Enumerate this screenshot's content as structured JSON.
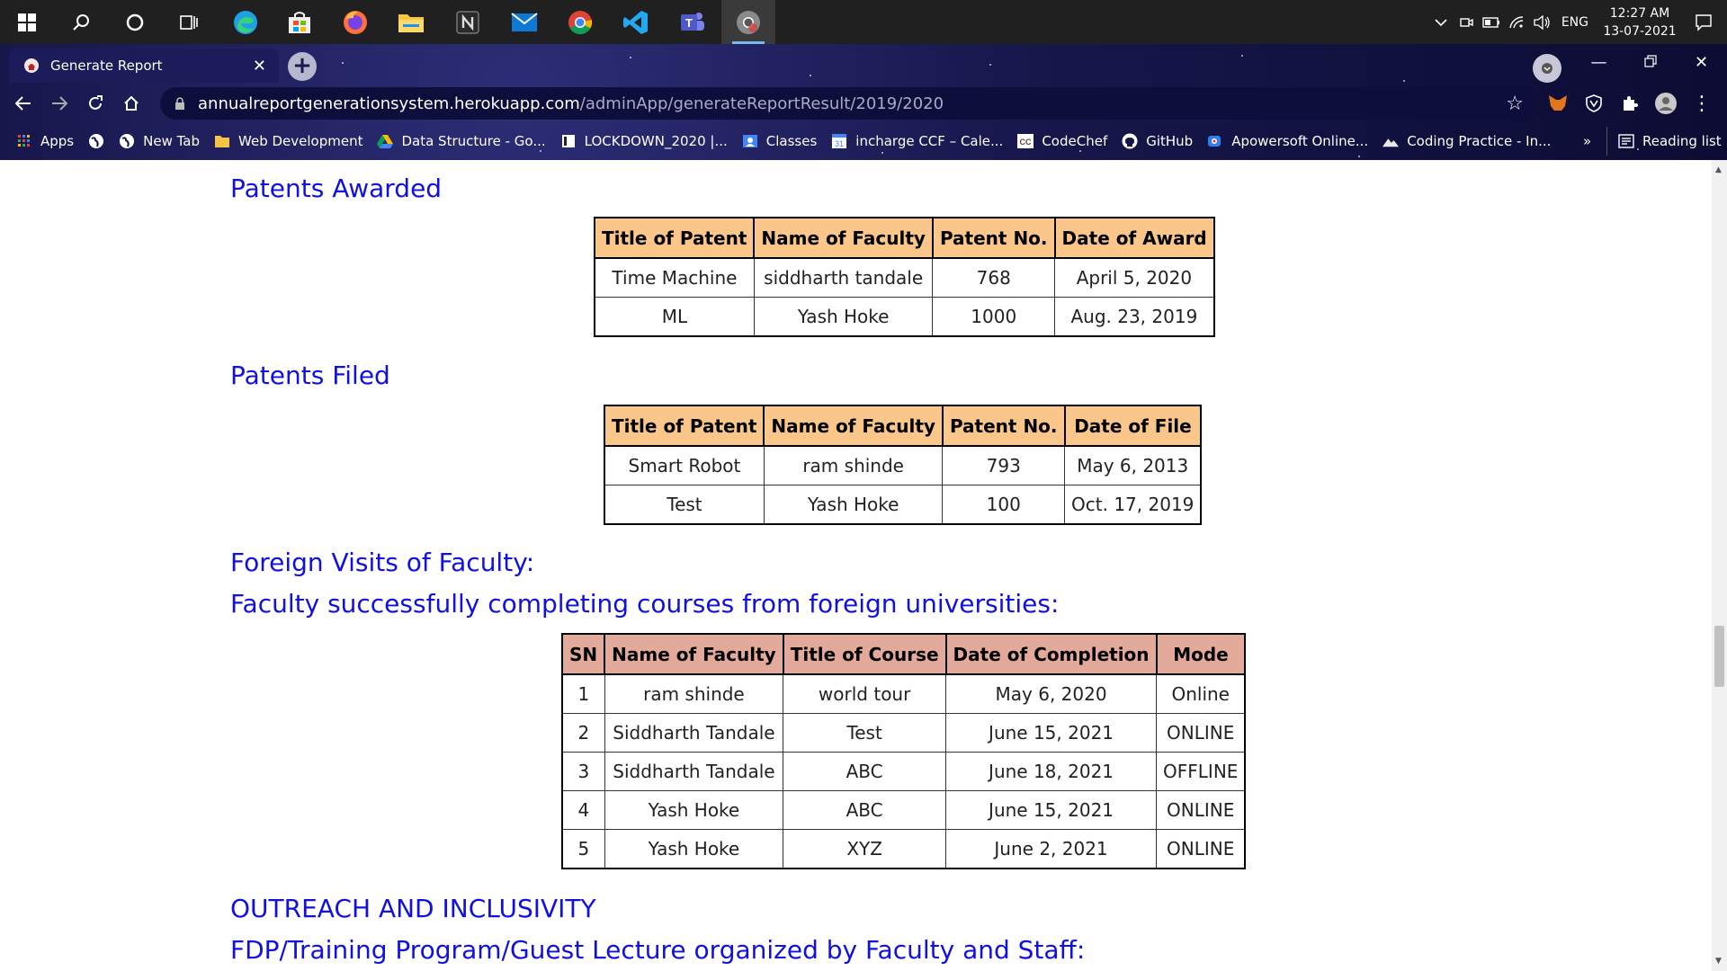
{
  "taskbar": {
    "apps": [
      "start-icon",
      "search-icon",
      "cortana-icon",
      "task-view-icon",
      "edge-icon",
      "store-icon",
      "firefox-icon",
      "file-explorer-icon",
      "notion-icon",
      "mail-icon",
      "chrome-icon",
      "vscode-icon",
      "teams-icon",
      "chrome-canary-icon"
    ],
    "language": "ENG",
    "time": "12:27 AM",
    "date": "13-07-2021"
  },
  "browser": {
    "tab_title": "Generate Report",
    "url_host": "annualreportgenerationsystem.herokuapp.com",
    "url_path": "/adminApp/generateReportResult/2019/2020",
    "bookmarks": [
      {
        "label": "Apps",
        "icon": "apps-grid-icon"
      },
      {
        "label": "",
        "icon": "globe-icon"
      },
      {
        "label": "New Tab",
        "icon": "globe-icon"
      },
      {
        "label": "Web Development",
        "icon": "folder-icon"
      },
      {
        "label": "Data Structure - Go...",
        "icon": "drive-icon"
      },
      {
        "label": "LOCKDOWN_2020 |...",
        "icon": "page-icon"
      },
      {
        "label": "Classes",
        "icon": "classroom-icon"
      },
      {
        "label": "incharge CCF – Cale...",
        "icon": "calendar-icon"
      },
      {
        "label": "CodeChef",
        "icon": "codechef-icon"
      },
      {
        "label": "GitHub",
        "icon": "github-icon"
      },
      {
        "label": "Apowersoft Online...",
        "icon": "apowersoft-icon"
      },
      {
        "label": "Coding Practice - In...",
        "icon": "mountain-icon"
      }
    ],
    "more_bookmarks": "»",
    "reading_list": "Reading list"
  },
  "page": {
    "patents_awarded": {
      "heading": "Patents Awarded",
      "columns": [
        "Title of Patent",
        "Name of Faculty",
        "Patent No.",
        "Date of Award"
      ],
      "rows": [
        [
          "Time Machine",
          "siddharth tandale",
          "768",
          "April 5, 2020"
        ],
        [
          "ML",
          "Yash Hoke",
          "1000",
          "Aug. 23, 2019"
        ]
      ]
    },
    "patents_filed": {
      "heading": "Patents Filed",
      "columns": [
        "Title of Patent",
        "Name of Faculty",
        "Patent No.",
        "Date of File"
      ],
      "rows": [
        [
          "Smart Robot",
          "ram shinde",
          "793",
          "May 6, 2013"
        ],
        [
          "Test",
          "Yash Hoke",
          "100",
          "Oct. 17, 2019"
        ]
      ]
    },
    "foreign_visits": {
      "heading": "Foreign Visits of Faculty:"
    },
    "foreign_courses": {
      "heading": "Faculty successfully completing courses from foreign universities:",
      "columns": [
        "SN",
        "Name of Faculty",
        "Title of Course",
        "Date of Completion",
        "Mode"
      ],
      "rows": [
        [
          "1",
          "ram shinde",
          "world tour",
          "May 6, 2020",
          "Online"
        ],
        [
          "2",
          "Siddharth Tandale",
          "Test",
          "June 15, 2021",
          "ONLINE"
        ],
        [
          "3",
          "Siddharth Tandale",
          "ABC",
          "June 18, 2021",
          "OFFLINE"
        ],
        [
          "4",
          "Yash Hoke",
          "ABC",
          "June 15, 2021",
          "ONLINE"
        ],
        [
          "5",
          "Yash Hoke",
          "XYZ",
          "June 2, 2021",
          "ONLINE"
        ]
      ]
    },
    "outreach": {
      "heading": "OUTREACH AND INCLUSIVITY"
    },
    "fdp": {
      "heading": "FDP/Training Program/Guest Lecture organized by Faculty and Staff:"
    }
  }
}
